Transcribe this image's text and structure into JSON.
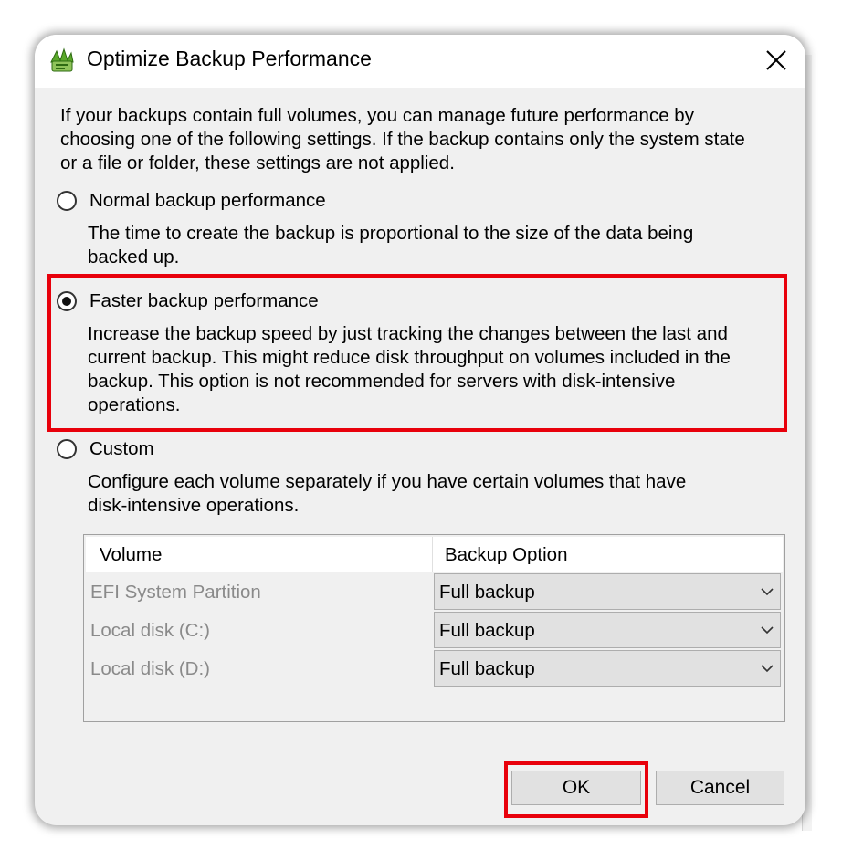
{
  "dialog": {
    "title": "Optimize Backup Performance",
    "icon": "backup-app-icon",
    "close_icon": "close-icon"
  },
  "intro": {
    "line1": "If your backups contain full volumes, you can manage future performance by",
    "line2": "choosing one of the following settings. If the backup contains only the system state",
    "line3": "or a file or folder, these settings are not applied."
  },
  "options": {
    "normal": {
      "label": "Normal backup performance",
      "selected": false,
      "desc1": "The time to create the backup is proportional to the size of the data being",
      "desc2": "backed up."
    },
    "faster": {
      "label": "Faster backup performance",
      "selected": true,
      "desc1": "Increase the backup speed by just tracking the changes between the last and",
      "desc2": "current backup.  This might reduce disk throughput on volumes included in the",
      "desc3": "backup. This option is not recommended for servers with disk-intensive",
      "desc4": "operations."
    },
    "custom": {
      "label": "Custom",
      "selected": false,
      "desc1": "Configure each volume separately if you have certain volumes that have",
      "desc2": "disk-intensive operations."
    }
  },
  "volume_table": {
    "columns": [
      "Volume",
      "Backup Option"
    ],
    "rows": [
      {
        "volume": "EFI System Partition",
        "option": "Full backup"
      },
      {
        "volume": "Local disk (C:)",
        "option": "Full backup"
      },
      {
        "volume": "Local disk (D:)",
        "option": "Full backup"
      }
    ]
  },
  "buttons": {
    "ok": "OK",
    "cancel": "Cancel"
  },
  "colors": {
    "highlight": "#e8000b",
    "dialog_bg": "#f0f0f0",
    "disabled_text": "#8a8a8a"
  }
}
